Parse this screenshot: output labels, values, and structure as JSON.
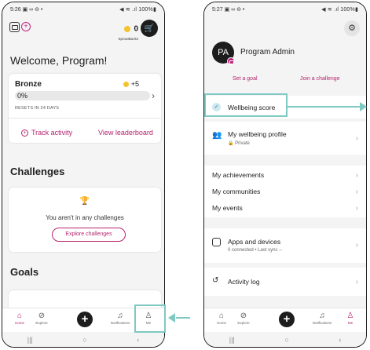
{
  "phone1": {
    "status": {
      "time": "5:26",
      "left_icons": "▣ ∞ ⊖ •",
      "right": "◀ ≋ .ıl 100%▮"
    },
    "spruce_bucks": {
      "count": "0",
      "label": "SproutBucks"
    },
    "welcome": "Welcome, Program!",
    "tier_card": {
      "tier": "Bronze",
      "points": "+5",
      "progress_text": "0%",
      "progress_fraction": 0,
      "resets": "RESETS IN 24 DAYS",
      "track_activity": "Track activity",
      "view_leaderboard": "View leaderboard"
    },
    "challenges": {
      "heading": "Challenges",
      "empty_text": "You aren't in any challenges",
      "explore_button": "Explore challenges"
    },
    "goals": {
      "heading": "Goals"
    },
    "nav": {
      "items": [
        {
          "label": "Home",
          "icon": "home-icon"
        },
        {
          "label": "Explore",
          "icon": "compass-icon"
        },
        {
          "label": "Notifications",
          "icon": "bell-icon"
        },
        {
          "label": "Me",
          "icon": "person-icon"
        }
      ],
      "active": "Home"
    }
  },
  "phone2": {
    "status": {
      "time": "5:27",
      "left_icons": "▣ ∞ ⊖ •",
      "right": "◀ ≋ .ıl 100%▮"
    },
    "avatar_initials": "PA",
    "profile_name": "Program Admin",
    "set_goal": "Set a goal",
    "join_challenge": "Join a challenge",
    "rows": {
      "wellbeing_score": "Wellbeing score",
      "wellbeing_profile": "My wellbeing profile",
      "wellbeing_profile_sub": "Private",
      "achievements": "My achievements",
      "communities": "My communities",
      "events": "My events",
      "apps_devices": "Apps and devices",
      "apps_devices_sub": "0 connected • Last sync --",
      "activity_log": "Activity log"
    },
    "nav": {
      "items": [
        {
          "label": "Home",
          "icon": "home-icon"
        },
        {
          "label": "Explore",
          "icon": "compass-icon"
        },
        {
          "label": "Notifications",
          "icon": "bell-icon"
        },
        {
          "label": "Me",
          "icon": "person-icon"
        }
      ],
      "active": "Me"
    }
  },
  "colors": {
    "accent": "#b5246f",
    "highlight": "#7fc9c3",
    "dark": "#1d1d1d"
  }
}
